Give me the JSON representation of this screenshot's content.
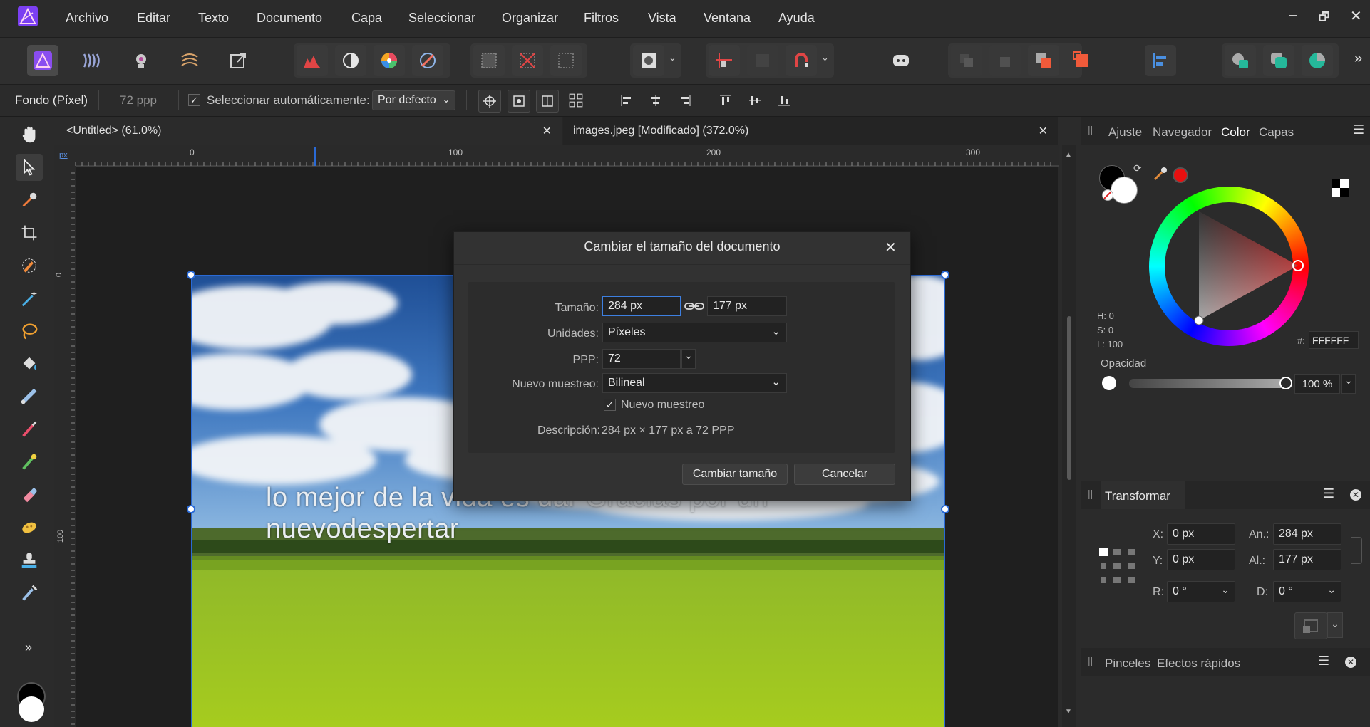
{
  "menu": {
    "items": [
      "Archivo",
      "Editar",
      "Texto",
      "Documento",
      "Capa",
      "Seleccionar",
      "Organizar",
      "Filtros",
      "Vista",
      "Ventana",
      "Ayuda"
    ],
    "window_controls": {
      "minimize": "–",
      "restore": "🗗",
      "close": "✕"
    }
  },
  "toolbar": {
    "overflow": "»"
  },
  "context": {
    "layer_label": "Fondo (Píxel)",
    "dpi_label": "72 ppp",
    "auto_select_label": "Seleccionar automáticamente:",
    "auto_select_checked": true,
    "auto_select_value": "Por defecto"
  },
  "tools": {
    "overflow": "»"
  },
  "tabs": [
    {
      "label": "<Untitled> (61.0%)",
      "close": "✕"
    },
    {
      "label": "images.jpeg [Modificado] (372.0%)",
      "close": "✕"
    }
  ],
  "ruler": {
    "unit": "px",
    "top_ticks": [
      "0",
      "100",
      "200",
      "300"
    ],
    "left_ticks": [
      "0",
      "100"
    ]
  },
  "image": {
    "caption_line1": "lo mejor de la vida es dar Gracias por un",
    "caption_line2": "nuevodespertar"
  },
  "dialog": {
    "title": "Cambiar el tamaño del documento",
    "close": "✕",
    "size_label": "Tamaño:",
    "width_value": "284 px",
    "height_value": "177 px",
    "units_label": "Unidades:",
    "units_value": "Píxeles",
    "dpi_label": "PPP:",
    "dpi_value": "72",
    "resample_label": "Nuevo muestreo:",
    "resample_value": "Bilineal",
    "resample_checkbox_label": "Nuevo muestreo",
    "resample_checked": true,
    "description_label": "Descripción:",
    "description_value": "284 px × 177 px a 72 PPP",
    "resize_button": "Cambiar tamaño",
    "cancel_button": "Cancelar"
  },
  "right_panel": {
    "top_tabs": [
      "Ajuste",
      "Navegador",
      "Color",
      "Capas"
    ],
    "active_tab": "Color",
    "color": {
      "h": "H: 0",
      "s": "S: 0",
      "l": "L: 100",
      "hex_label": "#:",
      "hex_value": "FFFFFF",
      "opacity_label": "Opacidad",
      "opacity_value": "100 %",
      "opacity_fraction": 1.0,
      "swatch_fg": "#000000",
      "swatch_bg": "#ffffff",
      "picked_color": "#ff0000"
    },
    "transform": {
      "title": "Transformar",
      "x_label": "X:",
      "x_value": "0 px",
      "y_label": "Y:",
      "y_value": "0 px",
      "w_label": "An.:",
      "w_value": "284 px",
      "h_label": "Al.:",
      "h_value": "177 px",
      "r_label": "R:",
      "r_value": "0 °",
      "d_label": "D:",
      "d_value": "0 °"
    },
    "bottom_tabs": [
      "Pinceles",
      "Efectos rápidos"
    ]
  },
  "colors": {
    "accent": "#2a6ad6",
    "affinity_brand": "#7c4dff"
  }
}
